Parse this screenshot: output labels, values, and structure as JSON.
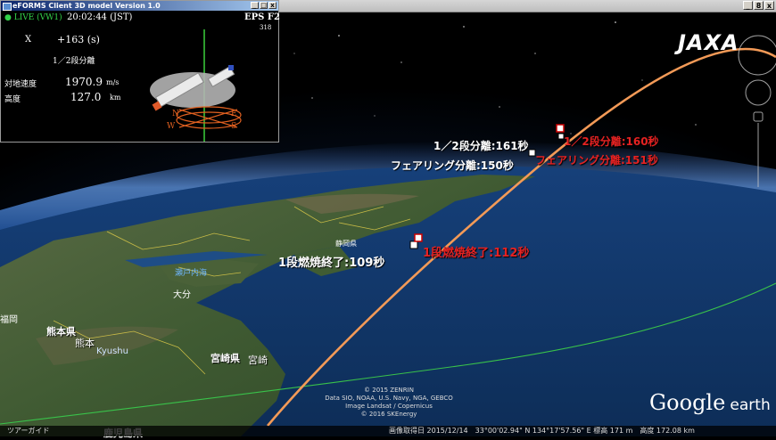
{
  "panel": {
    "title": "eFORMS Client 3D model Version 1.0",
    "live": "● LIVE (VW1)",
    "time": "20:02:44 (JST)",
    "eps": "EPS F2",
    "eps_sub": "318",
    "x_label": "X",
    "x_value": "+163 (s)",
    "event": "1／2段分離",
    "speed_label": "対地速度",
    "speed_value": "1970.9",
    "speed_unit": "m/s",
    "alt_label": "高度",
    "alt_value": "127.0",
    "alt_unit": "km",
    "compass": [
      "N",
      "E",
      "W",
      "S"
    ]
  },
  "window_controls": [
    "_",
    "□",
    "x"
  ],
  "ge_window_controls": [
    "_",
    "8",
    "x"
  ],
  "logo": "JAXA",
  "google_logo": {
    "google": "Google",
    "earth": "earth"
  },
  "events_actual": {
    "stage1_burnout": "1段燃焼終了:109秒",
    "fairing_sep": "フェアリング分離:150秒",
    "stage_sep": "1／2段分離:161秒"
  },
  "events_planned": {
    "stage1_burnout": "1段燃焼終了:112秒",
    "fairing_sep": "フェアリング分離:151秒",
    "stage_sep": "1／2段分離:160秒"
  },
  "map_labels": {
    "seto": "瀬戸内海",
    "oita": "大分",
    "kumamoto_pref": "熊本県",
    "kumamoto": "熊本",
    "kyushu": "Kyushu",
    "miyazaki_pref": "宮崎県",
    "miyazaki": "宮崎",
    "kagoshima": "鹿児島県",
    "left_edge": "福岡",
    "shizuoka": "静岡県"
  },
  "attribution": [
    "© 2015 ZENRIN",
    "Data SIO, NOAA, U.S. Navy, NGA, GEBCO",
    "Image Landsat / Copernicus",
    "© 2016 SKEnergy"
  ],
  "status_left": "ツアーガイド",
  "status_right": "画像取得日 2015/12/14　33°00'02.94\" N 134°17'57.56\" E 標高 171 m　高度 172.08 km"
}
